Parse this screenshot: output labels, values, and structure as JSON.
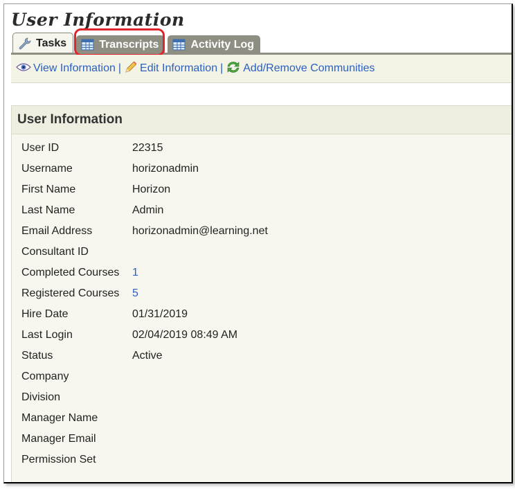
{
  "page": {
    "title": "User Information"
  },
  "tabs": [
    {
      "label": "Tasks",
      "icon": "wrench-icon",
      "active": true
    },
    {
      "label": "Transcripts",
      "icon": "table-icon",
      "active": false
    },
    {
      "label": "Activity Log",
      "icon": "table-icon",
      "active": false
    }
  ],
  "actions": [
    {
      "label": "View Information",
      "icon": "eye-icon"
    },
    {
      "label": "Edit Information",
      "icon": "pencil-icon"
    },
    {
      "label": "Add/Remove Communities",
      "icon": "refresh-icon"
    }
  ],
  "actions_separator": "|",
  "panel": {
    "title": "User Information"
  },
  "fields": [
    {
      "label": "User ID",
      "value": "22315"
    },
    {
      "label": "Username",
      "value": "horizonadmin"
    },
    {
      "label": "First Name",
      "value": "Horizon"
    },
    {
      "label": "Last Name",
      "value": "Admin"
    },
    {
      "label": "Email Address",
      "value": "horizonadmin@learning.net"
    },
    {
      "label": "Consultant ID",
      "value": ""
    },
    {
      "label": "Completed Courses",
      "value": "1",
      "link": true
    },
    {
      "label": "Registered Courses",
      "value": "5",
      "link": true
    },
    {
      "label": "Hire Date",
      "value": "01/31/2019"
    },
    {
      "label": "Last Login",
      "value": "02/04/2019 08:49 AM"
    },
    {
      "label": "Status",
      "value": "Active"
    },
    {
      "label": "Company",
      "value": ""
    },
    {
      "label": "Division",
      "value": ""
    },
    {
      "label": "Manager Name",
      "value": ""
    },
    {
      "label": "Manager Email",
      "value": ""
    },
    {
      "label": "Permission Set",
      "value": ""
    }
  ],
  "colors": {
    "link": "#2b60c2",
    "tab_inactive": "#8e8e82",
    "highlight": "#e0242a",
    "panel_bg": "#f7f7ef"
  }
}
